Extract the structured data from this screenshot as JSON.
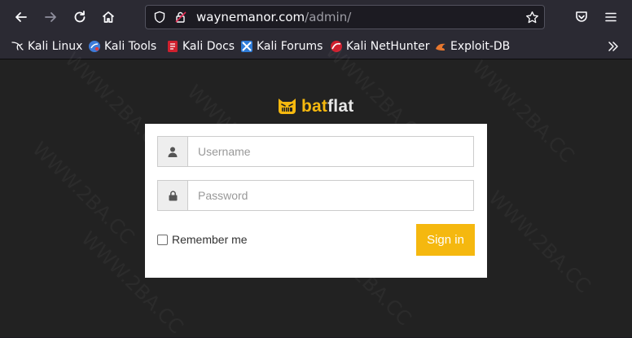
{
  "browser": {
    "url_host": "waynemanor.com",
    "url_path": "/admin/"
  },
  "bookmarks": [
    {
      "label": "Kali Linux",
      "icon": "kali-dragon-icon"
    },
    {
      "label": "Kali Tools",
      "icon": "kali-tools-icon"
    },
    {
      "label": "Kali Docs",
      "icon": "kali-docs-icon"
    },
    {
      "label": "Kali Forums",
      "icon": "kali-forums-icon"
    },
    {
      "label": "Kali NetHunter",
      "icon": "kali-nethunter-icon"
    },
    {
      "label": "Exploit-DB",
      "icon": "exploit-db-icon"
    }
  ],
  "logo": {
    "part1": "bat",
    "part2": "flat",
    "accent_color": "#f5b80f"
  },
  "login": {
    "username_placeholder": "Username",
    "password_placeholder": "Password",
    "remember_label": "Remember me",
    "signin_label": "Sign in"
  },
  "watermark": "WWW.2BA.CC"
}
